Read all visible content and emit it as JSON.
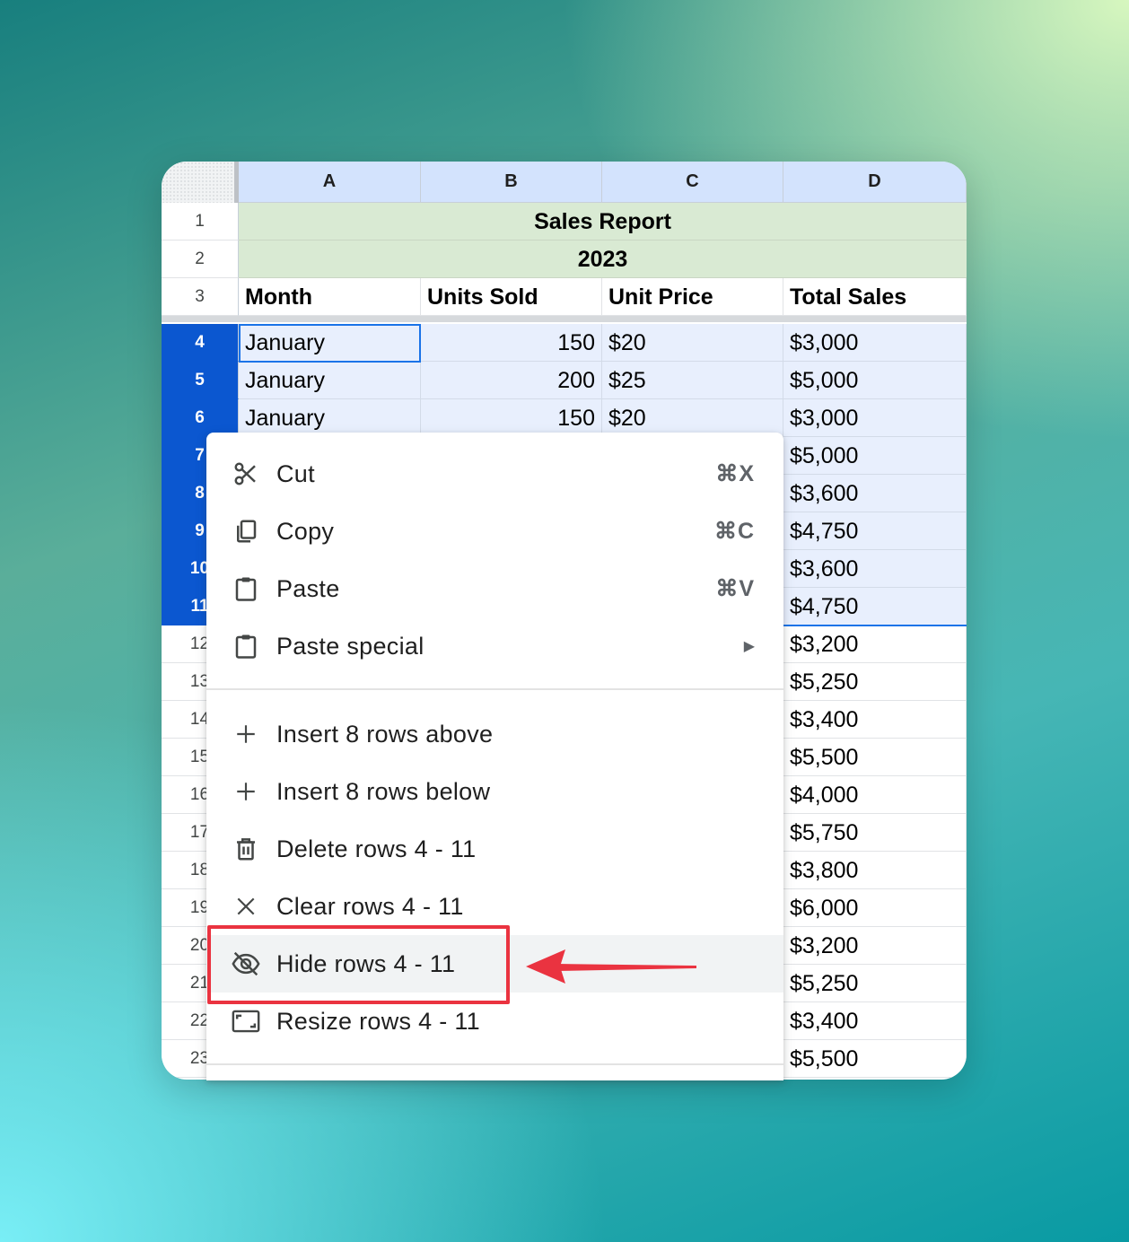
{
  "sheet": {
    "columns": [
      "A",
      "B",
      "C",
      "D"
    ],
    "title_row": {
      "row": "1",
      "text": "Sales Report"
    },
    "year_row": {
      "row": "2",
      "text": "2023"
    },
    "header_row": {
      "row": "3",
      "cells": [
        "Month",
        "Units Sold",
        "Unit Price",
        "Total Sales"
      ]
    },
    "data_rows": [
      {
        "row": "4",
        "a": "January",
        "b": "150",
        "c": "$20",
        "d": "$3,000",
        "selected": true
      },
      {
        "row": "5",
        "a": "January",
        "b": "200",
        "c": "$25",
        "d": "$5,000",
        "selected": true
      },
      {
        "row": "6",
        "a": "January",
        "b": "150",
        "c": "$20",
        "d": "$3,000",
        "selected": true
      },
      {
        "row": "7",
        "a": "",
        "b": "",
        "c": "",
        "d": "$5,000",
        "selected": true
      },
      {
        "row": "8",
        "a": "",
        "b": "",
        "c": "",
        "d": "$3,600",
        "selected": true
      },
      {
        "row": "9",
        "a": "",
        "b": "",
        "c": "",
        "d": "$4,750",
        "selected": true
      },
      {
        "row": "10",
        "a": "",
        "b": "",
        "c": "",
        "d": "$3,600",
        "selected": true
      },
      {
        "row": "11",
        "a": "",
        "b": "",
        "c": "",
        "d": "$4,750",
        "selected": true
      },
      {
        "row": "12",
        "a": "",
        "b": "",
        "c": "",
        "d": "$3,200",
        "selected": false
      },
      {
        "row": "13",
        "a": "",
        "b": "",
        "c": "",
        "d": "$5,250",
        "selected": false
      },
      {
        "row": "14",
        "a": "",
        "b": "",
        "c": "",
        "d": "$3,400",
        "selected": false
      },
      {
        "row": "15",
        "a": "",
        "b": "",
        "c": "",
        "d": "$5,500",
        "selected": false
      },
      {
        "row": "16",
        "a": "",
        "b": "",
        "c": "",
        "d": "$4,000",
        "selected": false
      },
      {
        "row": "17",
        "a": "",
        "b": "",
        "c": "",
        "d": "$5,750",
        "selected": false
      },
      {
        "row": "18",
        "a": "",
        "b": "",
        "c": "",
        "d": "$3,800",
        "selected": false
      },
      {
        "row": "19",
        "a": "",
        "b": "",
        "c": "",
        "d": "$6,000",
        "selected": false
      },
      {
        "row": "20",
        "a": "",
        "b": "",
        "c": "",
        "d": "$3,200",
        "selected": false
      },
      {
        "row": "21",
        "a": "",
        "b": "",
        "c": "",
        "d": "$5,250",
        "selected": false
      },
      {
        "row": "22",
        "a": "",
        "b": "",
        "c": "",
        "d": "$3,400",
        "selected": false
      },
      {
        "row": "23",
        "a": "",
        "b": "",
        "c": "",
        "d": "$5,500",
        "selected": false
      }
    ]
  },
  "context_menu": {
    "cut": {
      "label": "Cut",
      "shortcut": "⌘X"
    },
    "copy": {
      "label": "Copy",
      "shortcut": "⌘C"
    },
    "paste": {
      "label": "Paste",
      "shortcut": "⌘V"
    },
    "paste_special": {
      "label": "Paste special",
      "submenu_glyph": "▶"
    },
    "insert_above": {
      "label": "Insert 8 rows above"
    },
    "insert_below": {
      "label": "Insert 8 rows below"
    },
    "delete_rows": {
      "label": "Delete rows 4 - 11"
    },
    "clear_rows": {
      "label": "Clear rows 4 - 11"
    },
    "hide_rows": {
      "label": "Hide rows 4 - 11"
    },
    "resize_rows": {
      "label": "Resize rows 4 - 11"
    }
  },
  "colors": {
    "selection_header": "#0b57d0",
    "selection_fill": "#e8effd",
    "title_fill": "#d9ead3",
    "annotation_red": "#ea3340"
  },
  "icons": [
    "scissors-icon",
    "copy-icon",
    "clipboard-icon",
    "plus-icon",
    "trash-icon",
    "close-icon",
    "eye-off-icon",
    "resize-icon",
    "submenu-arrow-icon"
  ]
}
